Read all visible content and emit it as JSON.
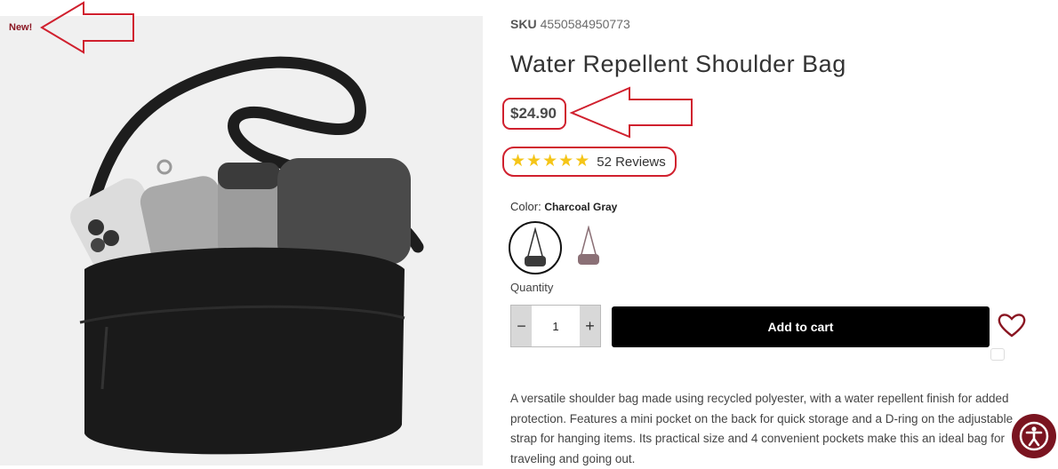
{
  "product": {
    "badge": "New!",
    "sku_label": "SKU",
    "sku_value": "4550584950773",
    "title": "Water Repellent Shoulder Bag",
    "price": "$24.90",
    "rating_stars": 5,
    "reviews": "52 Reviews",
    "color_label": "Color:",
    "color_value": "Charcoal Gray",
    "swatches": [
      {
        "name": "Charcoal Gray",
        "selected": true,
        "color": "#3a3a3a"
      },
      {
        "name": "Purple",
        "selected": false,
        "color": "#8b7076"
      }
    ],
    "quantity_label": "Quantity",
    "quantity": "1",
    "minus": "−",
    "plus": "+",
    "add_to_cart": "Add to cart",
    "description_lines": [
      "A versatile shoulder bag made using recycled polyester, with a water repellent finish for added",
      "protection. Features a mini pocket on the back for quick storage and a D-ring on the adjustable",
      "strap for hanging items. Its practical size and 4 convenient pockets make this an ideal bag for",
      "traveling and going out."
    ]
  },
  "colors": {
    "annotation": "#d0202e",
    "star": "#f5c518",
    "badge": "#8a1622",
    "accessibility_button": "#7a1420"
  },
  "icons": {
    "wishlist": "heart-icon",
    "accessibility": "accessibility-icon"
  }
}
